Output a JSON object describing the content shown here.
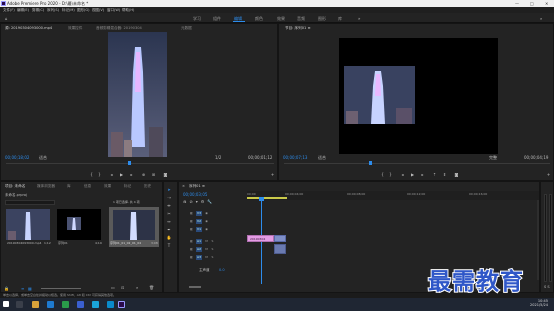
{
  "window": {
    "title": "Adobe Premiere Pro 2020 - D:\\最\\未命名 *",
    "min": "—",
    "max": "□",
    "close": "✕"
  },
  "menu": [
    "文件(F)",
    "编辑(E)",
    "剪辑(C)",
    "序列(S)",
    "标记(M)",
    "图形(G)",
    "视图(V)",
    "窗口(W)",
    "帮助(H)"
  ],
  "workspaces": [
    "学习",
    "组件",
    "编辑",
    "颜色",
    "效果",
    "音频",
    "图形",
    "库"
  ],
  "active_workspace": "编辑",
  "source": {
    "tabs": [
      "源: 20190304093000.mp4",
      "效果控件",
      "音频剪辑混合器: 20190304",
      "元数据"
    ],
    "timecode": "00;00;18;02",
    "fit": "适合",
    "fraction": "1/2",
    "duration": "00;00;01;12"
  },
  "program": {
    "tab": "节目: 序列01 ≡",
    "timecode": "00;00;07;13",
    "fit": "适合",
    "fraction": "完整",
    "duration": "00;00;04;19"
  },
  "project": {
    "tabs": [
      "项目: 未命名",
      "媒体浏览器",
      "库",
      "信息",
      "效果",
      "标记",
      "历史"
    ],
    "file": "未命名.prproj",
    "count": "1 项已选择, 共 4 项",
    "items": [
      {
        "name": "20190304093000.mp4",
        "dur": "1;12"
      },
      {
        "name": "序列01",
        "dur": "4;19"
      },
      {
        "name": "序列01_01_02_01_04",
        "dur": "3;08"
      }
    ]
  },
  "timeline": {
    "tab": "序列01 ≡",
    "timecode": "00;00;03;05",
    "ruler": [
      "00;00",
      "00;00;04;00",
      "00;00;08;00",
      "00;00;12;00",
      "00;00;16;00"
    ],
    "tracks_v": [
      "V3",
      "V2",
      "V1"
    ],
    "tracks_a": [
      "A1",
      "A2",
      "A3"
    ],
    "master": "主声道",
    "master_val": "0.0",
    "clip_label": "20190304"
  },
  "status": "单击以选择，或单击空白处并拖动以框选。使用 Shift、Alt 和 Ctrl 可获得其他选项。",
  "watermark": "最需教育",
  "clock": {
    "time": "10:45",
    "date": "2021/5/24"
  }
}
